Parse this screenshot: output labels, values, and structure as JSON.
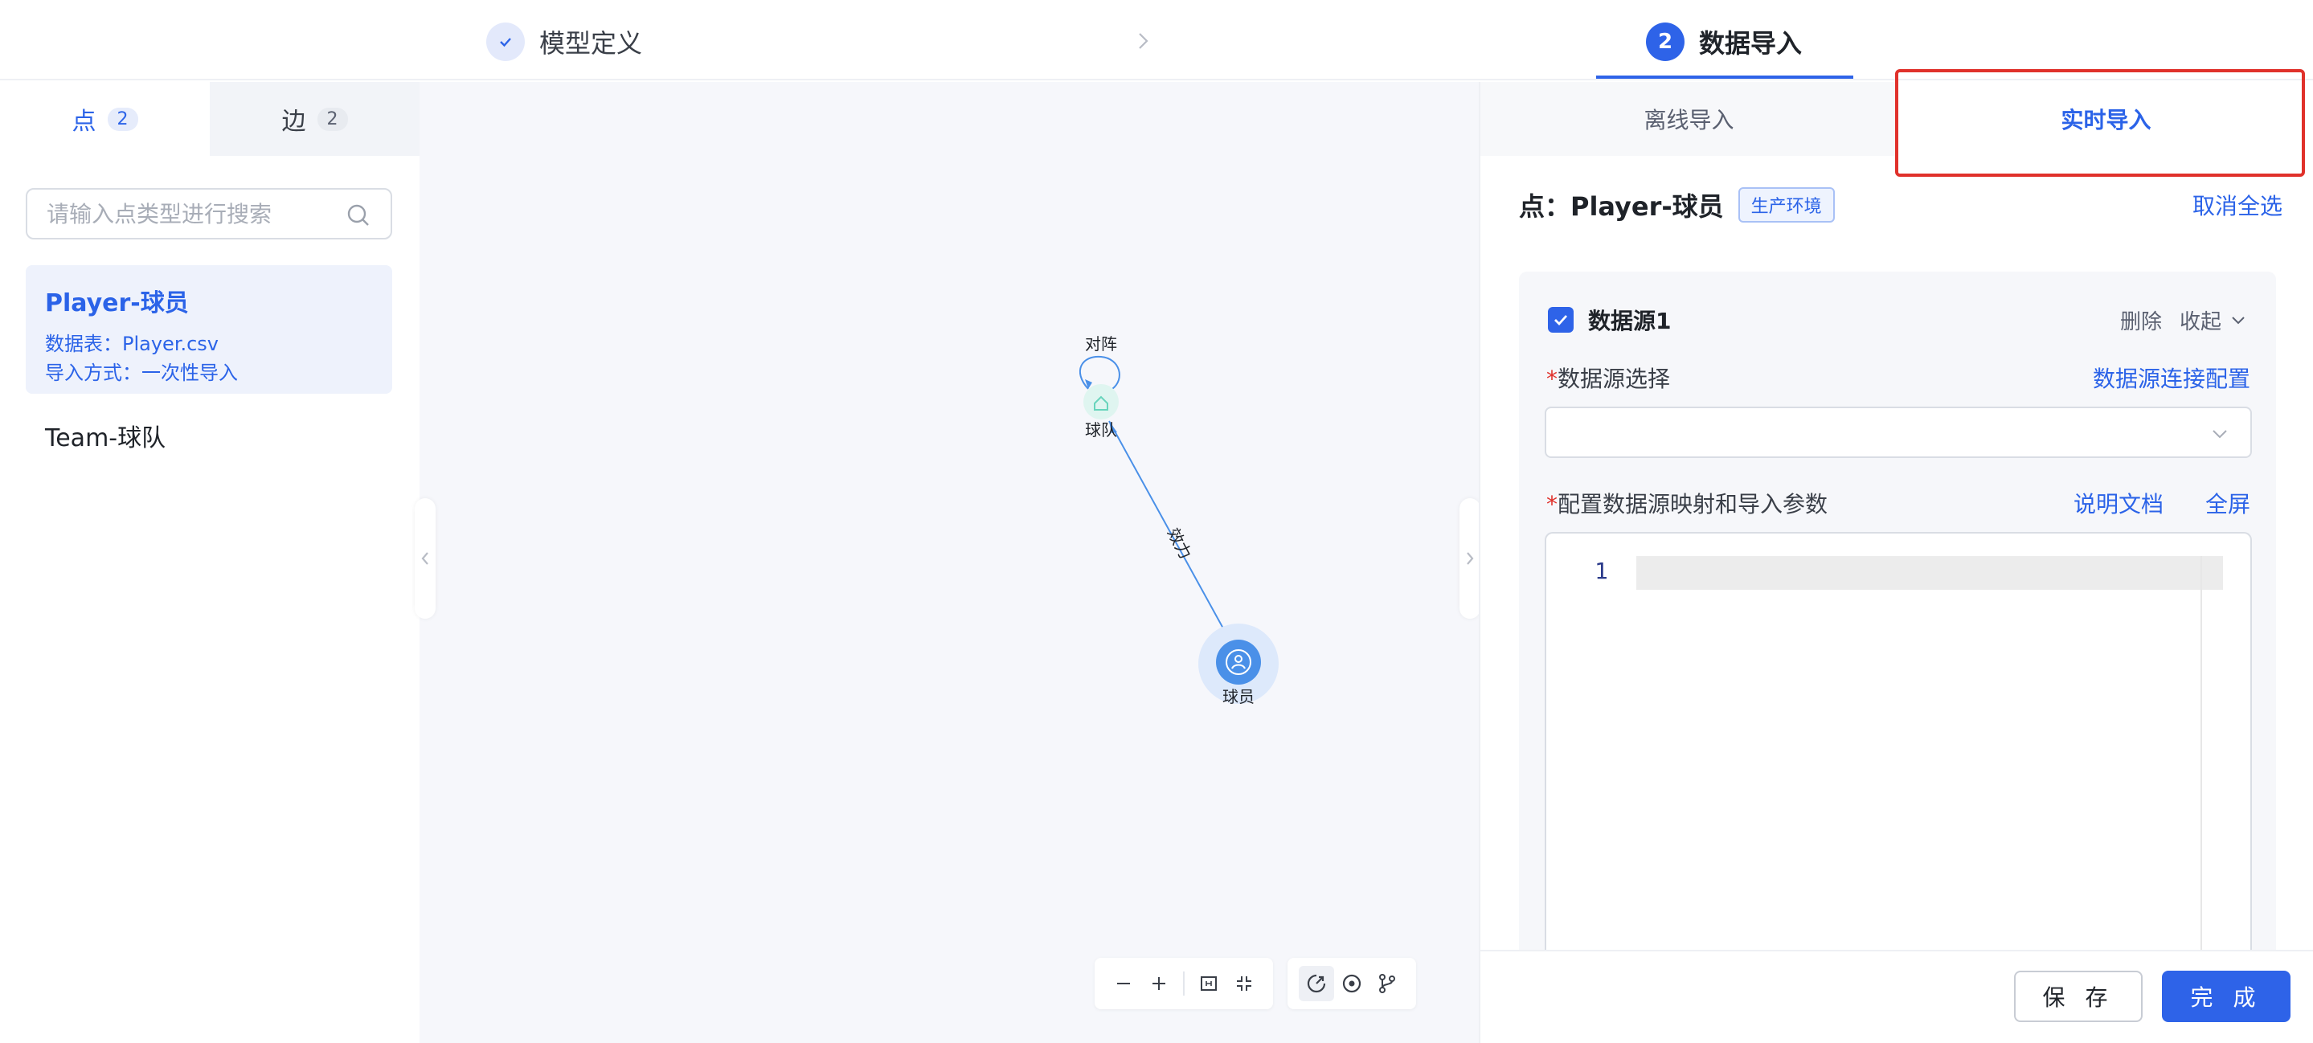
{
  "steps": [
    {
      "label": "模型定义",
      "state": "done"
    },
    {
      "label": "数据导入",
      "number": "2",
      "state": "active"
    }
  ],
  "left": {
    "tabs": [
      {
        "label": "点",
        "count": "2"
      },
      {
        "label": "边",
        "count": "2"
      }
    ],
    "search_placeholder": "请输入点类型进行搜索",
    "items": [
      {
        "name": "Player-球员",
        "table": "数据表：Player.csv",
        "mode": "导入方式：一次性导入"
      },
      {
        "name": "Team-球队"
      }
    ]
  },
  "graph": {
    "nodes": [
      {
        "label": "球队",
        "icon": "home-icon"
      },
      {
        "label": "球员",
        "icon": "user-icon"
      }
    ],
    "edges": [
      {
        "label": "对阵",
        "from": "球队",
        "to": "球队"
      },
      {
        "label": "效力",
        "from": "球员",
        "to": "球队"
      }
    ],
    "toolbar": [
      "zoom-out-icon",
      "zoom-in-icon",
      "fit-view-icon",
      "compress-icon",
      "layout-icon",
      "focus-icon",
      "branch-icon"
    ]
  },
  "right": {
    "tabs": [
      {
        "label": "离线导入"
      },
      {
        "label": "实时导入"
      }
    ],
    "title": "点：Player-球员",
    "env_tag": "生产环境",
    "deselect_all": "取消全选",
    "card": {
      "title": "数据源1",
      "delete": "删除",
      "collapse": "收起",
      "source_label": "数据源选择",
      "source_link": "数据源连接配置",
      "mapping_label": "配置数据源映射和导入参数",
      "doc_link": "说明文档",
      "fullscreen_link": "全屏",
      "line_number": "1"
    },
    "save": "保 存",
    "done": "完 成"
  },
  "colors": {
    "accent": "#2e63e8",
    "highlight": "#e0312b"
  }
}
